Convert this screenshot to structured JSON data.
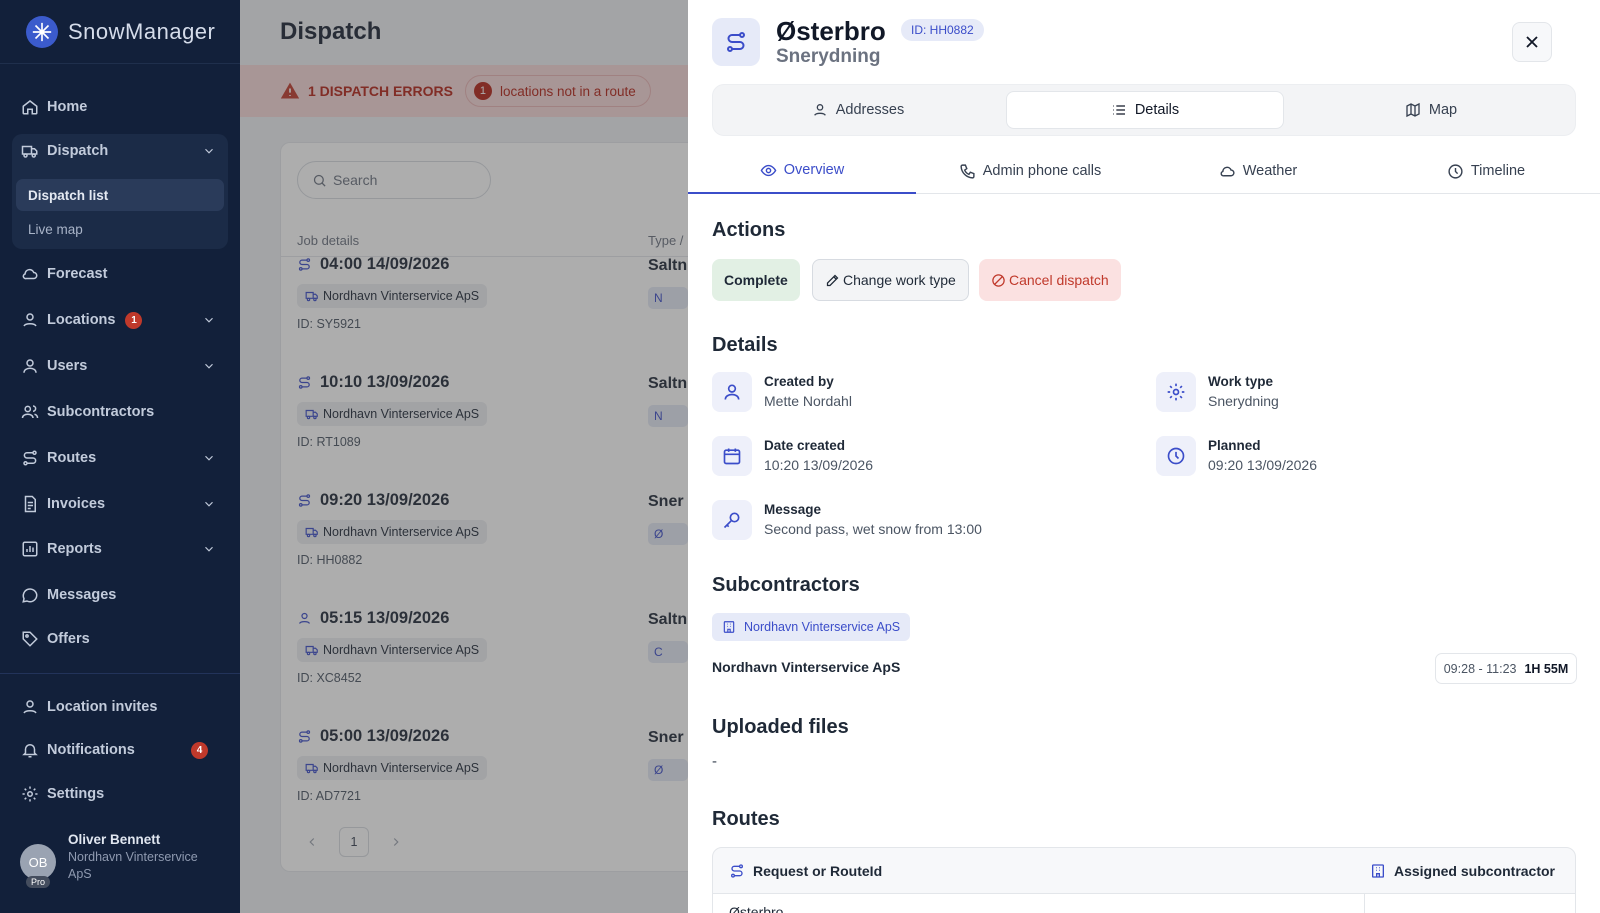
{
  "app": {
    "name": "SnowManager"
  },
  "sidebar": {
    "home": "Home",
    "dispatch": "Dispatch",
    "dispatch_list": "Dispatch list",
    "live_map": "Live map",
    "forecast": "Forecast",
    "locations": "Locations",
    "locations_badge": "1",
    "users": "Users",
    "subcontractors": "Subcontractors",
    "routes": "Routes",
    "invoices": "Invoices",
    "reports": "Reports",
    "messages": "Messages",
    "offers": "Offers",
    "location_invites": "Location invites",
    "notifications": "Notifications",
    "notifications_badge": "4",
    "settings": "Settings",
    "user": {
      "initials": "OB",
      "plan": "Pro",
      "name": "Oliver Bennett",
      "org": "Nordhavn Vinterservice ApS"
    }
  },
  "main": {
    "title": "Dispatch",
    "errors": {
      "label": "1 DISPATCH ERRORS",
      "count": "1",
      "pill_text": "locations not in a route"
    },
    "search_placeholder": "Search",
    "col_job": "Job details",
    "col_type": "Type /",
    "jobs": [
      {
        "time": "04:00 14/09/2026",
        "company": "Nordhavn Vinterservice ApS",
        "id": "ID: SY5921",
        "type": "Saltn",
        "tag": "N"
      },
      {
        "time": "10:10 13/09/2026",
        "company": "Nordhavn Vinterservice ApS",
        "id": "ID: RT1089",
        "type": "Saltn",
        "tag": "N"
      },
      {
        "time": "09:20 13/09/2026",
        "company": "Nordhavn Vinterservice ApS",
        "id": "ID: HH0882",
        "type": "Sner",
        "tag": "Ø"
      },
      {
        "time": "05:15 13/09/2026",
        "company": "Nordhavn Vinterservice ApS",
        "id": "ID: XC8452",
        "type": "Saltn",
        "tag": "C"
      },
      {
        "time": "05:00 13/09/2026",
        "company": "Nordhavn Vinterservice ApS",
        "id": "ID: AD7721",
        "type": "Sner",
        "tag": "Ø"
      }
    ],
    "page": "1"
  },
  "panel": {
    "title": "Østerbro",
    "id_badge": "ID: HH0882",
    "subtitle": "Snerydning",
    "segments": {
      "addresses": "Addresses",
      "details": "Details",
      "map": "Map"
    },
    "tabs": {
      "overview": "Overview",
      "calls": "Admin phone calls",
      "weather": "Weather",
      "timeline": "Timeline"
    },
    "actions_title": "Actions",
    "actions": {
      "complete": "Complete",
      "change": "Change work type",
      "cancel": "Cancel dispatch"
    },
    "details_title": "Details",
    "details": {
      "created_by_label": "Created by",
      "created_by": "Mette Nordahl",
      "work_type_label": "Work type",
      "work_type": "Snerydning",
      "date_created_label": "Date created",
      "date_created": "10:20 13/09/2026",
      "planned_label": "Planned",
      "planned": "09:20 13/09/2026",
      "message_label": "Message",
      "message": "Second pass, wet snow from 13:00"
    },
    "subcontractors_title": "Subcontractors",
    "subcontractor_chip": "Nordhavn Vinterservice ApS",
    "subcontractor_name": "Nordhavn Vinterservice ApS",
    "time_range": "09:28 - 11:23",
    "duration": "1H 55M",
    "files_title": "Uploaded files",
    "files_empty": "-",
    "routes_title": "Routes",
    "routes_col1": "Request or RouteId",
    "routes_col2": "Assigned subcontractor",
    "routes_row1": "Østerbro"
  }
}
